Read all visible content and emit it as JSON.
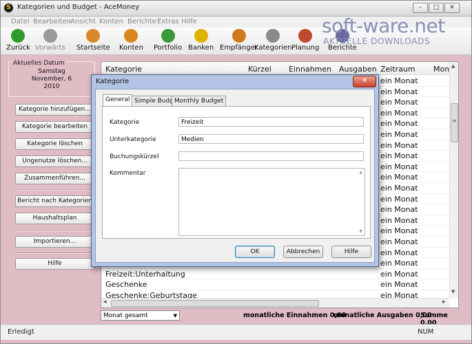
{
  "window": {
    "title": "Kategorien und Budget - AceMoney",
    "controls": [
      "–",
      "□",
      "✕"
    ]
  },
  "menu": [
    "Datei",
    "Bearbeiten",
    "Ansicht",
    "Konten",
    "Berichte",
    "Extras",
    "Hilfe"
  ],
  "toolbar": [
    {
      "label": "Zurück",
      "icon": "back-arrow-icon",
      "color": "#2e9a2e"
    },
    {
      "label": "Vorwärts",
      "icon": "forward-arrow-icon",
      "color": "#9a9a9a"
    },
    {
      "label": "Startseite",
      "icon": "home-icon",
      "color": "#d88a2a"
    },
    {
      "label": "Konten",
      "icon": "accounts-book-icon",
      "color": "#d9871c"
    },
    {
      "label": "Portfolio",
      "icon": "portfolio-icon",
      "color": "#3a9a3a"
    },
    {
      "label": "Banken",
      "icon": "bank-coin-icon",
      "color": "#e0b000"
    },
    {
      "label": "Empfänger",
      "icon": "payee-person-icon",
      "color": "#d07a20"
    },
    {
      "label": "Kategorien",
      "icon": "categories-box-icon",
      "color": "#8a8a8a"
    },
    {
      "label": "Planung",
      "icon": "planning-notepad-icon",
      "color": "#c04a30"
    },
    {
      "label": "Berichte",
      "icon": "reports-icon",
      "color": "#6a6aa0"
    }
  ],
  "watermark": {
    "line1": "soft-ware.net",
    "line2": "AKTUELLE DOWNLOADS"
  },
  "date_box": {
    "label": "Aktuelles Datum",
    "day": "Samstag",
    "date": "November, 6",
    "year": "2010"
  },
  "left_buttons": [
    "Kategorie hinzufügen...",
    "Kategorie bearbeiten",
    "Kategorie löschen",
    "Ungenutze löschen...",
    "Zusammenführen...",
    "Bericht nach Kategorien",
    "Haushaltsplan",
    "Importieren...",
    "Hilfe"
  ],
  "grid": {
    "columns": [
      "Kategorie",
      "Kürzel",
      "Einnahmen",
      "Ausgaben",
      "Zeitraum",
      "Mon"
    ],
    "rows": [
      {
        "name": "",
        "period": "ein Monat"
      },
      {
        "name": "",
        "period": "ein Monat"
      },
      {
        "name": "",
        "period": "ein Monat"
      },
      {
        "name": "",
        "period": "ein Monat"
      },
      {
        "name": "",
        "period": "ein Monat"
      },
      {
        "name": "",
        "period": "ein Monat"
      },
      {
        "name": "",
        "period": "ein Monat"
      },
      {
        "name": "",
        "period": "ein Monat"
      },
      {
        "name": "",
        "period": "ein Monat"
      },
      {
        "name": "",
        "period": "ein Monat"
      },
      {
        "name": "",
        "period": "ein Monat"
      },
      {
        "name": "",
        "period": "ein Monat"
      },
      {
        "name": "",
        "period": "ein Monat"
      },
      {
        "name": "",
        "period": "ein Monat"
      },
      {
        "name": "",
        "period": "ein Monat"
      },
      {
        "name": "",
        "period": "ein Monat"
      },
      {
        "name": "",
        "period": "ein Monat"
      },
      {
        "name": "",
        "period": "ein Monat"
      },
      {
        "name": "Freizeit:Unterhaltung",
        "period": "ein Monat"
      },
      {
        "name": "Geschenke",
        "period": "ein Monat"
      },
      {
        "name": "Geschenke:Geburtstage",
        "period": "ein Monat"
      }
    ],
    "scroll_glyphs": {
      "up": "▲",
      "down": "▼",
      "left": "◂",
      "right": "▸",
      "grip": "≡"
    }
  },
  "bottom": {
    "select_value": "Monat gesamt",
    "income": "monatliche Einnahmen 0,00",
    "expenses": "monatliche Ausgaben 0,00",
    "sum": "Summe 0,00"
  },
  "status": {
    "text": "Erledigt",
    "num": "NUM"
  },
  "dialog": {
    "title": "Kategorie",
    "close": "✕",
    "tabs": [
      "General",
      "Simple Budget",
      "Monthly Budget"
    ],
    "fields": [
      {
        "label": "Kategorie",
        "value": "Freizeit"
      },
      {
        "label": "Unterkategorie",
        "value": "Medien"
      },
      {
        "label": "Buchungskürzel",
        "value": ""
      }
    ],
    "comment_label": "Kommentar",
    "buttons": {
      "ok": "OK",
      "cancel": "Abbrechen",
      "help": "Hilfe"
    }
  }
}
